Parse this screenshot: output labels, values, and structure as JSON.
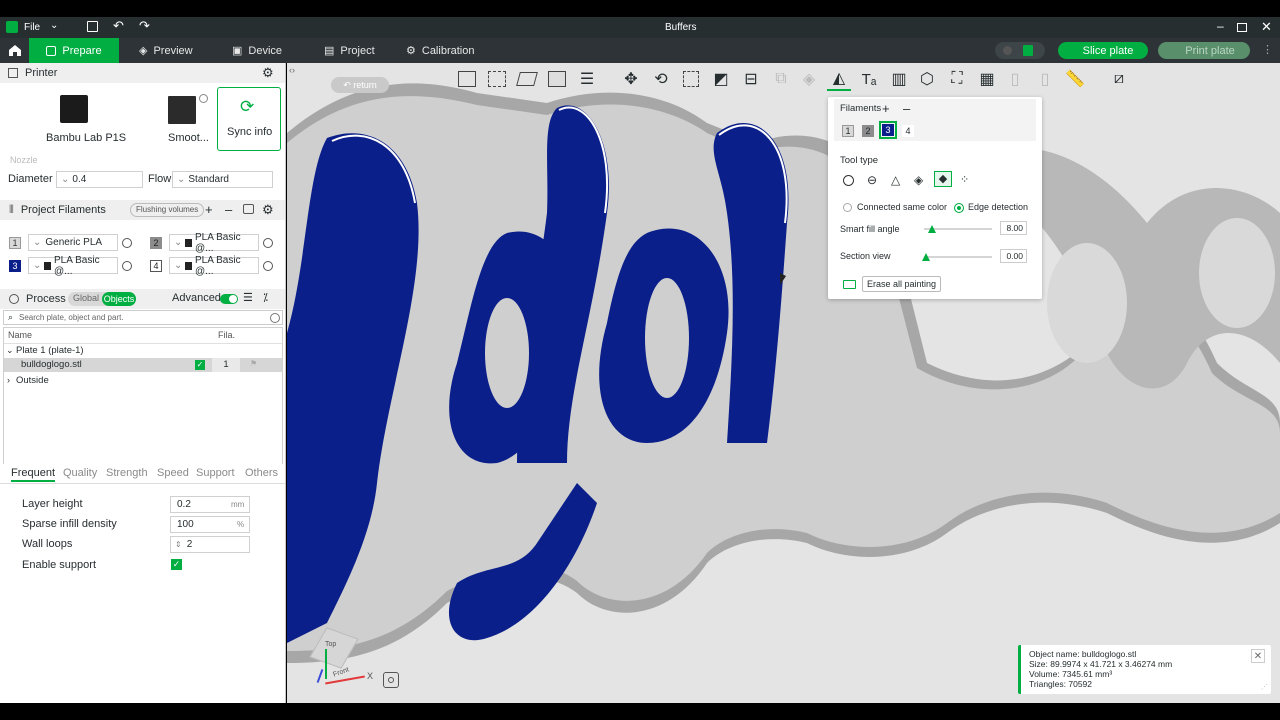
{
  "window": {
    "title": "Buffers",
    "file_menu": "File"
  },
  "nav": {
    "tabs": [
      {
        "label": "Prepare",
        "icon": "cube-icon"
      },
      {
        "label": "Preview",
        "icon": "layers-icon"
      },
      {
        "label": "Device",
        "icon": "device-icon"
      },
      {
        "label": "Project",
        "icon": "project-icon"
      },
      {
        "label": "Calibration",
        "icon": "calibration-icon"
      }
    ],
    "slice_label": "Slice plate",
    "print_label": "Print plate"
  },
  "printer": {
    "header": "Printer",
    "name": "Bambu Lab P1S",
    "plate": "Smoot...",
    "sync_label": "Sync info",
    "nozzle_label": "Nozzle",
    "diameter_label": "Diameter",
    "diameter_value": "0.4",
    "flow_label": "Flow",
    "flow_value": "Standard"
  },
  "filaments": {
    "header": "Project Filaments",
    "flushing": "Flushing volumes",
    "items": [
      {
        "num": "1",
        "name": "Generic PLA",
        "color": "#d9d9d9"
      },
      {
        "num": "2",
        "name": "PLA Basic @...",
        "color": "#8c8c8c"
      },
      {
        "num": "3",
        "name": "PLA Basic @...",
        "color": "#0b1f8a"
      },
      {
        "num": "4",
        "name": "PLA Basic @...",
        "color": "#ffffff"
      }
    ]
  },
  "process": {
    "header": "Process",
    "global_label": "Global",
    "objects_label": "Objects",
    "advanced_label": "Advanced",
    "search_placeholder": "Search plate, object and part.",
    "col_name": "Name",
    "col_fila": "Fila.",
    "plate_label": "Plate 1 (plate-1)",
    "object_name": "bulldoglogo.stl",
    "object_fila": "1",
    "outside_label": "Outside"
  },
  "settings_tabs": [
    "Frequent",
    "Quality",
    "Strength",
    "Speed",
    "Support",
    "Others"
  ],
  "settings": [
    {
      "label": "Layer height",
      "value": "0.2",
      "unit": "mm"
    },
    {
      "label": "Sparse infill density",
      "value": "100",
      "unit": "%"
    },
    {
      "label": "Wall loops",
      "value": "2",
      "unit": ""
    },
    {
      "label": "Enable support",
      "value": "",
      "unit": ""
    }
  ],
  "viewport": {
    "return_label": "return",
    "cube_top": "Top",
    "cube_front": "Front",
    "axis_x": "X"
  },
  "paint": {
    "filaments_label": "Filaments",
    "filament_nums": [
      "1",
      "2",
      "3",
      "4"
    ],
    "tool_type_label": "Tool type",
    "connected_label": "Connected same color",
    "edge_label": "Edge detection",
    "smart_fill_label": "Smart fill angle",
    "smart_fill_value": "8.00",
    "section_label": "Section view",
    "section_value": "0.00",
    "erase_label": "Erase all painting"
  },
  "info": {
    "name": "Object name: bulldoglogo.stl",
    "size": "Size: 89.9974 x 41.721 x 3.46274 mm",
    "volume": "Volume: 7345.61 mm³",
    "triangles": "Triangles: 70592"
  },
  "colors": {
    "accent": "#00ae42",
    "navy_paint": "#0b1f8a",
    "model_gray": "#9a9a9a"
  }
}
